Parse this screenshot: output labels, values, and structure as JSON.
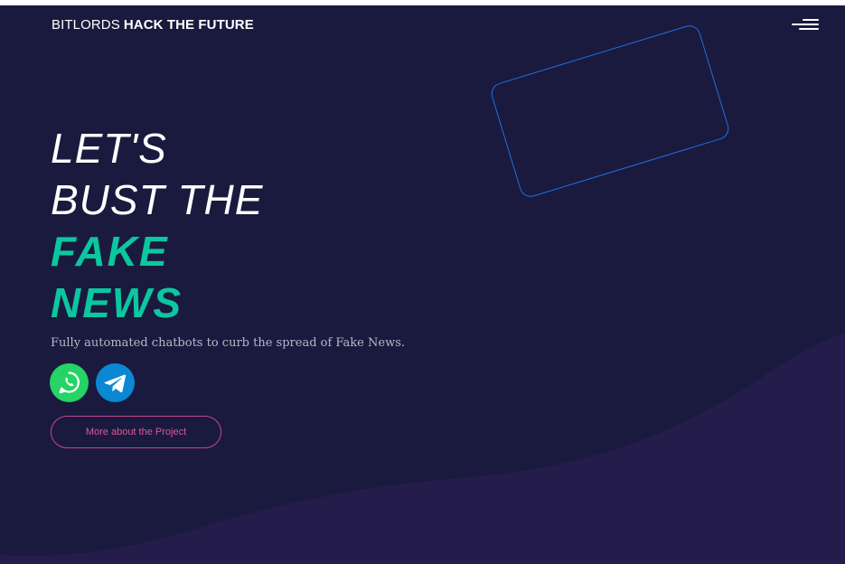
{
  "header": {
    "brand_light": "BITLORDS",
    "brand_bold": "HACK THE FUTURE",
    "menu_icon": "hamburger-menu-icon"
  },
  "hero": {
    "line1": "LET'S",
    "line2": "BUST THE",
    "accent_line1": "FAKE",
    "accent_line2": "NEWS",
    "subtitle": "Fully automated chatbots to curb the spread of Fake News."
  },
  "chat_links": [
    {
      "icon": "whatsapp-icon",
      "color": "#25d366"
    },
    {
      "icon": "telegram-icon",
      "color": "#0a88d4"
    }
  ],
  "cta": {
    "label": "More about the Project"
  },
  "colors": {
    "background": "#1a1a3e",
    "wave": "#241c4a",
    "accent": "#0bc7a0",
    "cta_border": "#c24b8a",
    "outline_card": "#1f6fe0"
  }
}
